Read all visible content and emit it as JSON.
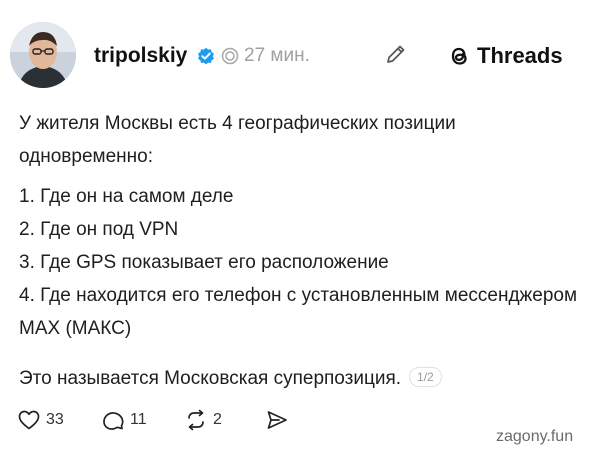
{
  "post": {
    "username": "tripolskiy",
    "time": "27 мин.",
    "brand": "Threads",
    "intro": "У жителя Москвы есть 4 географических позиции одновременно:",
    "list": [
      "1. Где он на самом деле",
      "2. Где он под VPN",
      "3. Где GPS показывает его расположение",
      "4. Где находится его телефон с установленным мессенджером MAX (МАКС)"
    ],
    "outro": "Это называется Московская суперпозиция.",
    "page_badge": "1/2"
  },
  "actions": {
    "likes": "33",
    "replies": "11",
    "reposts": "2"
  },
  "watermark": "zagony.fun",
  "colors": {
    "verified": "#1d9bf0",
    "text": "#1e1e1e",
    "muted": "#a0a0a0"
  },
  "icons": [
    "verified-badge-icon",
    "globe-icon",
    "edit-icon",
    "threads-logo-icon",
    "heart-icon",
    "reply-icon",
    "repost-icon",
    "share-icon"
  ]
}
